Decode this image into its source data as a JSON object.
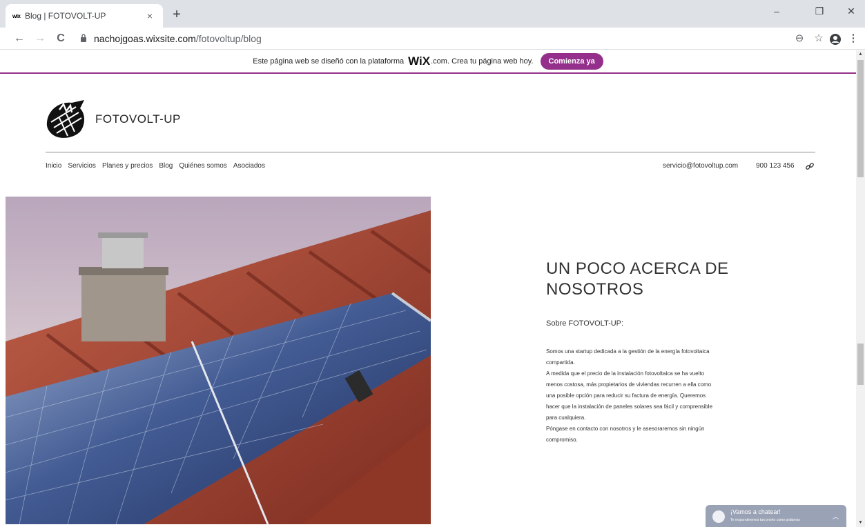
{
  "browser": {
    "tab": {
      "favicon": "wix",
      "title": "Blog | FOTOVOLT-UP",
      "close": "×"
    },
    "new_tab": "+",
    "window_controls": {
      "minimize": "–",
      "restore": "❐",
      "close": "✕"
    },
    "nav": {
      "back": "←",
      "forward": "→",
      "reload": "C"
    },
    "url": {
      "host": "nachojgoas.wixsite.com",
      "path": "/fotovoltup/blog"
    },
    "toolbar_icons": {
      "zoom": "⊖",
      "star": "☆",
      "menu": "⋮"
    }
  },
  "wix_banner": {
    "text_before": "Este página web se diseñó con la plataforma",
    "logo": "WiX",
    "text_after": ".com. Crea tu página web hoy.",
    "button": "Comienza ya"
  },
  "site": {
    "brand": "FOTOVOLT-UP",
    "nav": [
      "Inicio",
      "Servicios",
      "Planes y precios",
      "Blog",
      "Quiénes somos",
      "Asociados"
    ],
    "email": "servicio@fotovoltup.com",
    "phone": "900 123 456"
  },
  "about": {
    "title": "UN POCO ACERCA DE NOSOTROS",
    "subtitle": "Sobre FOTOVOLT-UP:",
    "body": "Somos una startup dedicada a la gestión de la energía fotovoltaica\ncompartida.\nA medida que el precio de la instalación fotovoltaica se ha vuelto\nmenos costosa, más propietarios de viviendas recurren a ella como\nuna posible opción para reducir su factura de energía. Queremos\nhacer que la instalación de paneles solares sea fácil y comprensible\npara cualquiera.\nPóngase en contacto con nosotros y le asesoraremos sin ningún\ncompromiso."
  },
  "chat": {
    "title": "¡Vamos a chatear!",
    "subtitle": "Te responderemos tan pronto como podamos"
  },
  "colors": {
    "wix_purple": "#94308c",
    "chat_bg": "#9aa2b6"
  }
}
